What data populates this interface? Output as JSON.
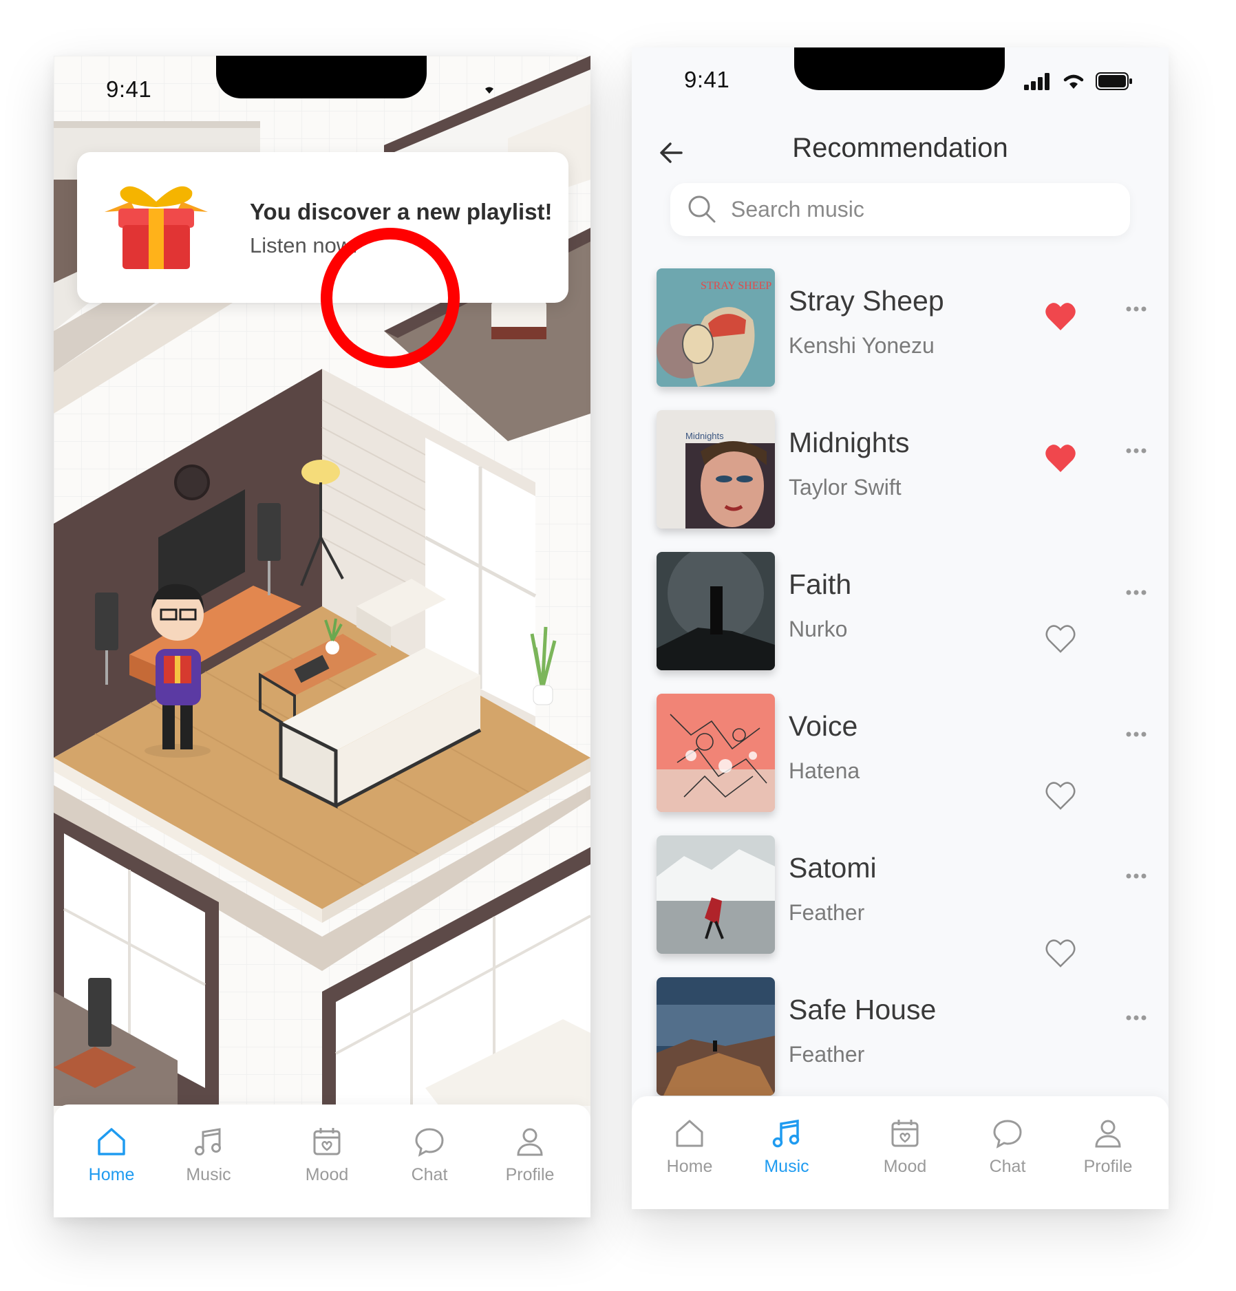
{
  "left_screen": {
    "status_time": "9:41",
    "notification": {
      "title": "You discover a new playlist!",
      "subtitle": "Listen now!"
    },
    "tabbar": {
      "active": "Home",
      "items": [
        {
          "label": "Home",
          "icon": "home-icon"
        },
        {
          "label": "Music",
          "icon": "music-note-icon"
        },
        {
          "label": "Mood",
          "icon": "calendar-heart-icon"
        },
        {
          "label": "Chat",
          "icon": "chat-bubble-icon"
        },
        {
          "label": "Profile",
          "icon": "person-icon"
        }
      ]
    }
  },
  "right_screen": {
    "status_time": "9:41",
    "title": "Recommendation",
    "search": {
      "placeholder": "Search music",
      "value": ""
    },
    "tracks": [
      {
        "title": "Stray Sheep",
        "artist": "Kenshi Yonezu",
        "liked": true
      },
      {
        "title": "Midnights",
        "artist": "Taylor Swift",
        "liked": true
      },
      {
        "title": "Faith",
        "artist": "Nurko",
        "liked": false
      },
      {
        "title": "Voice",
        "artist": "Hatena",
        "liked": false
      },
      {
        "title": "Satomi",
        "artist": "Feather",
        "liked": false
      },
      {
        "title": "Safe House",
        "artist": "Feather",
        "liked": false
      }
    ],
    "cover_texts": {
      "stray_sheep": "STRAY SHEEP",
      "midnights": "Midnights"
    },
    "tabbar": {
      "active": "Music",
      "items": [
        {
          "label": "Home",
          "icon": "home-icon"
        },
        {
          "label": "Music",
          "icon": "music-note-icon"
        },
        {
          "label": "Mood",
          "icon": "calendar-heart-icon"
        },
        {
          "label": "Chat",
          "icon": "chat-bubble-icon"
        },
        {
          "label": "Profile",
          "icon": "person-icon"
        }
      ]
    }
  },
  "colors": {
    "accent_blue": "#1f9bf0",
    "heart_red": "#f0474d",
    "annotation_red": "#ff0000",
    "inactive_gray": "#9a9a9a"
  }
}
